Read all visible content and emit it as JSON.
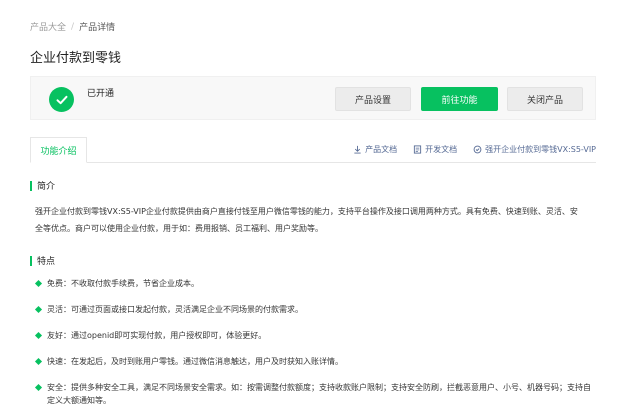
{
  "breadcrumb": {
    "root": "产品大全",
    "separator": "/",
    "current": "产品详情"
  },
  "page_title": "企业付款到零钱",
  "status": {
    "text": "已开通",
    "color": "#07c160"
  },
  "actions": {
    "settings": "产品设置",
    "go": "前往功能",
    "close": "关闭产品"
  },
  "tabs": {
    "active": "功能介绍"
  },
  "links": {
    "docs": "产品文档",
    "dev_docs": "开发文档",
    "vip": "强开企业付款到零钱VX:S5-VIP"
  },
  "intro": {
    "title": "简介",
    "text": "强开企业付款到零钱VX:S5-VIP企业付款提供由商户直接付钱至用户微信零钱的能力，支持平台操作及接口调用两种方式。具有免费、快速到账、灵活、安全等优点。商户可以使用企业付款，用于如：费用报销、员工福利、用户奖励等。"
  },
  "features": {
    "title": "特点",
    "items": [
      "免费：不收取付款手续费，节省企业成本。",
      "灵活：可通过页面或接口发起付款，灵活满足企业不同场景的付款需求。",
      "友好：通过openid即可实现付款，用户授权即可，体验更好。",
      "快速：在发起后，及时到账用户零钱。通过微信消息触达，用户及时获知入账详情。",
      "安全：提供多种安全工具，满足不同场景安全需求。如：按需调整付款额度；支持收款账户限制；支持安全防刷，拦截恶意用户、小号、机器号码；支持自定义大额通知等。"
    ]
  },
  "colors": {
    "accent": "#07c160",
    "link": "#576b95"
  }
}
